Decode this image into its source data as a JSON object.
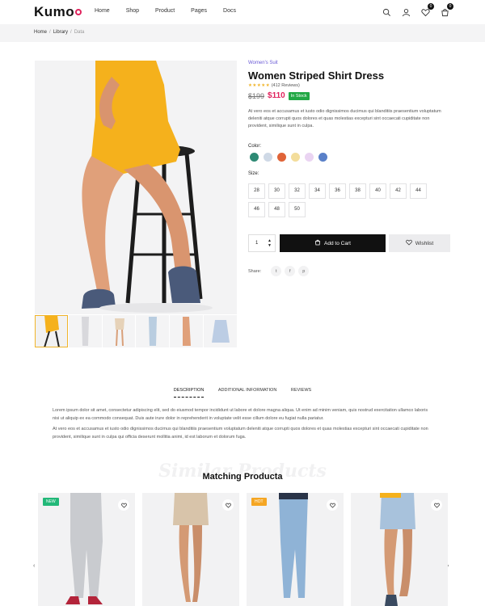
{
  "brand": {
    "logo_text": "Kumo",
    "accent": "#e0245e"
  },
  "nav": [
    "Home",
    "Shop",
    "Product",
    "Pages",
    "Docs"
  ],
  "header_icons": {
    "search": "search-icon",
    "user": "user-icon",
    "wishlist_count": "0",
    "cart_count": "0"
  },
  "breadcrumb": {
    "home": "Home",
    "library": "Library",
    "current": "Data"
  },
  "product": {
    "category": "Women's Suit",
    "title": "Women Striped Shirt Dress",
    "stars": "★★★★★",
    "reviews": "(412 Reviews)",
    "old_price": "$199",
    "price": "$110",
    "stock": "In Stock",
    "description": "At vero eos et accusamus et iusto odio dignissimos ducimus qui blanditiis praesentium voluptatum deleniti atque corrupti quos dolores et quas molestias excepturi sint occaecati cupiditate non provident, similique sunt in culpa.",
    "color_label": "Color:",
    "colors": [
      "#2e8a74",
      "#cfd9e6",
      "#e06438",
      "#f3dd9b",
      "#ead4f2",
      "#5a80c8"
    ],
    "size_label": "Size:",
    "sizes": [
      "28",
      "30",
      "32",
      "34",
      "36",
      "38",
      "40",
      "42",
      "44",
      "46",
      "48",
      "50"
    ],
    "quantity": "1",
    "add_to_cart": "Add to Cart",
    "wishlist": "Wishlist",
    "share_label": "Share:"
  },
  "tabs": {
    "items": [
      "DESCRIPTION",
      "ADDITIONAL INFORMATION",
      "REVIEWS"
    ],
    "para1": "Lorem ipsum dolor sit amet, consectetur adipiscing elit, sed do eiusmod tempor incididunt ut labore et dolore magna aliqua. Ut enim ad minim veniam, quis nostrud exercitation ullamco laboris nisi ut aliquip ex ea commodo consequat. Duis aute irure dolor in reprehenderit in voluptate velit esse cillum dolore eu fugiat nulla pariatur.",
    "para2": "At vero eos et accusamus et iusto odio dignissimos ducimus qui blanditiis praesentium voluptatum deleniti atque corrupti quos dolores et quas molestias excepturi sint occaecati cupiditate non provident, similique sunt in culpa qui officia deserunt mollitia animi, id est laborum et dolorum fuga."
  },
  "similar": {
    "ghost_title": "Similar Products",
    "title": "Matching Producta",
    "cards": [
      {
        "tag": "NEW",
        "tag_color": "#22b878"
      },
      {
        "tag": "",
        "tag_color": ""
      },
      {
        "tag": "HOT",
        "tag_color": "#f5a623"
      },
      {
        "tag": "",
        "tag_color": ""
      }
    ]
  }
}
